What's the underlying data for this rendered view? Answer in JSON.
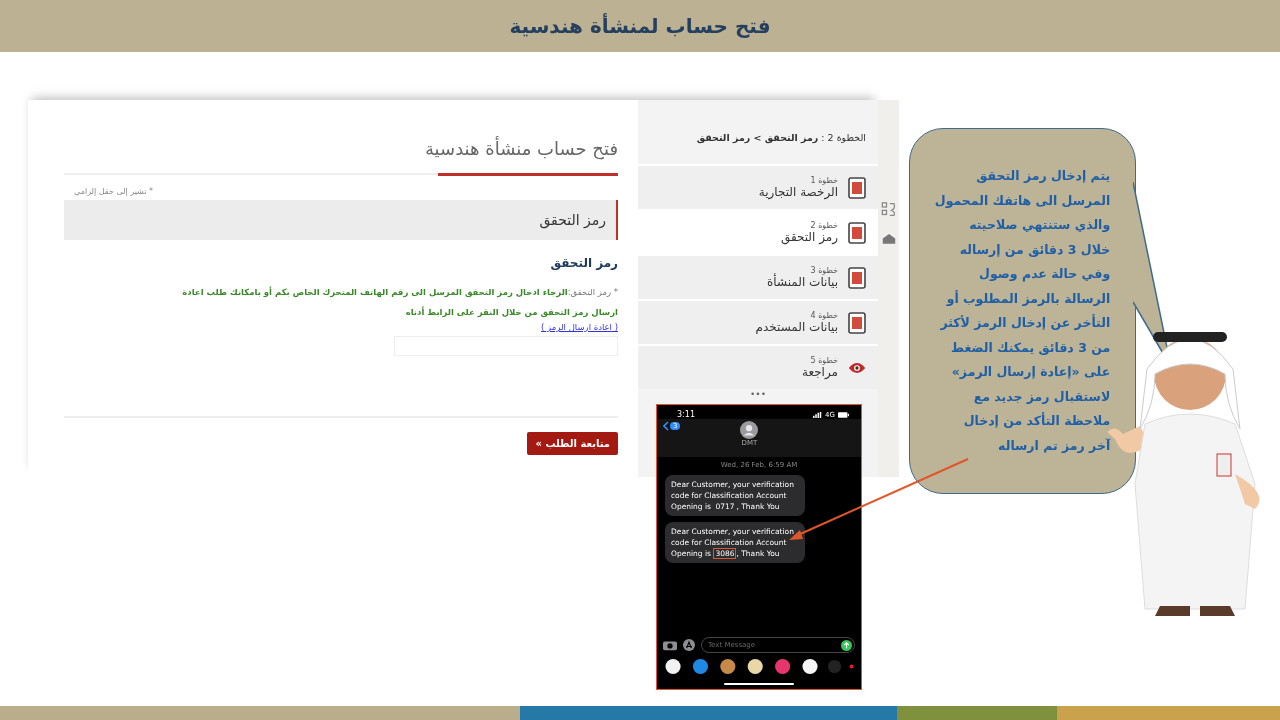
{
  "slide_title": "فتح حساب لمنشأة هندسية",
  "form": {
    "title": "فتح حساب منشأة هندسية",
    "required_note": "* تشير إلى حقل إلزامي",
    "section_title": "رمز التحقق",
    "field_heading": "رمز التحقق",
    "field_label": "* رمز التحقق:",
    "instructions": "الرجاء ادخال رمز التحقق المرسل الى رقم الهاتف المتحرك الخاص بكم أو بامكانك طلب اعادة ارسال رمز التحقق من خلال النقر على الرابط أدناه",
    "resend_link": "( اعادة ارسال الرمز )",
    "continue_button": "متابعة الطلب »"
  },
  "steps": {
    "breadcrumb": "الخطوة 2 : **رمز التحقق > رمز التحقق**",
    "more": "•••",
    "items": [
      {
        "step": "خطوة 1",
        "label": "الرخصة التجارية",
        "kind": "document",
        "selected": false
      },
      {
        "step": "خطوة 2",
        "label": "رمز التحقق",
        "kind": "document",
        "selected": true
      },
      {
        "step": "خطوة 3",
        "label": "بيانات المنشأة",
        "kind": "document",
        "selected": false
      },
      {
        "step": "خطوة 4",
        "label": "بيانات المستخدم",
        "kind": "document",
        "selected": false
      },
      {
        "step": "خطوة 5",
        "label": "مراجعة",
        "kind": "review",
        "selected": false
      }
    ]
  },
  "phone": {
    "time": "3:11",
    "network": "4G",
    "back_count": "3",
    "contact": "DMT",
    "date": "Wed, 26 Feb, 6:59 AM",
    "input_placeholder": "Text Message",
    "messages": [
      {
        "before": "Dear Customer, your verification code for Classification Account Opening is",
        "code": "0717",
        "after": ", Thank You",
        "highlighted": false
      },
      {
        "before": "Dear Customer, your verification code for Classification Account Opening is",
        "code": "3086",
        "after": ", Thank You",
        "highlighted": true
      }
    ]
  },
  "callout": {
    "text": "يتم إدخال رمز التحقق\nالمرسل الى هاتفك المحمول\nوالذي ستنتهي صلاحيته\nخلال 3 دقائق من إرساله\nوفي حالة عدم وصول\nالرسالة بالرمز المطلوب أو\nالتأخر عن إدخال الرمز لأكثر\nمن 3 دقائق يمكنك الضغط\nعلى «إعادة إرسال الرمز»\nلاستقبال رمز جديد مع\nملاحظة التأكد من إدخال\nآخر رمز تم ارساله"
  }
}
